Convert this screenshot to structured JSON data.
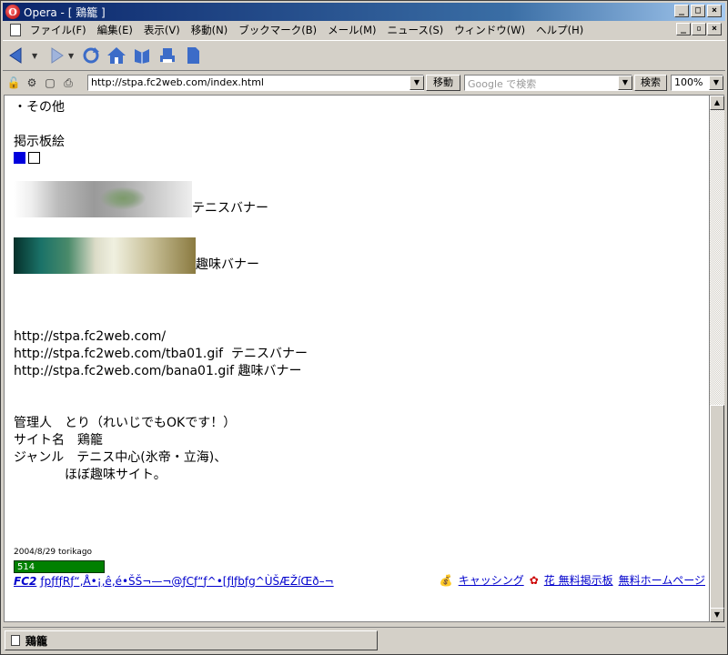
{
  "window": {
    "title": "Opera - [ 鶏籠 ]"
  },
  "menu": {
    "items": [
      "ファイル(F)",
      "編集(E)",
      "表示(V)",
      "移動(N)",
      "ブックマーク(B)",
      "メール(M)",
      "ニュース(S)",
      "ウィンドウ(W)",
      "ヘルプ(H)"
    ]
  },
  "address_bar": {
    "url": "http://stpa.fc2web.com/index.html",
    "go_label": "移動",
    "search_placeholder": "Google で検索",
    "search_label": "検索",
    "zoom": "100%"
  },
  "page": {
    "other": "・その他",
    "bbs_art": "掲示板絵",
    "tennis_banner_label": "テニスバナー",
    "hobby_banner_label": "趣味バナー",
    "url_site": "http://stpa.fc2web.com/",
    "url_tennis": "http://stpa.fc2web.com/tba01.gif",
    "url_tennis_label": "テニスバナー",
    "url_hobby": "http://stpa.fc2web.com/bana01.gif",
    "url_hobby_label": "趣味バナー",
    "admin": "管理人　とり（れいじでもOKです！）",
    "site_name": "サイト名　鶏籠",
    "genre": "ジャンル　テニス中心(氷帝・立海)、",
    "genre2": "ほぼ趣味サイト。",
    "date_credit": "2004/8/29 torikago",
    "counter": "514"
  },
  "footer": {
    "fc2": "FC2",
    "garbled": "ƒpƒfƒRƒ“‚Å•¡‚ê‚é•ŠŠ¬—¬@ƒCƒ“ƒ^•[ƒlƒbƒg^ÙŠÆŽíŒð–¬",
    "cashing": "キャッシング",
    "bbs": "花 無料掲示板",
    "homepage": "無料ホームページ"
  },
  "tab": {
    "label": "鶏籠"
  }
}
